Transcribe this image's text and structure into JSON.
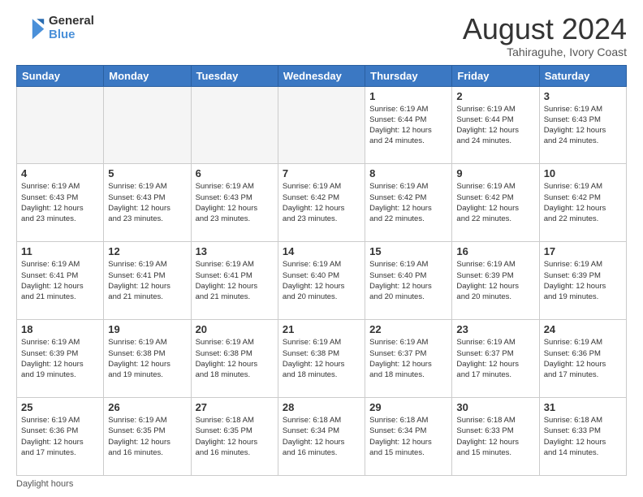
{
  "logo": {
    "line1": "General",
    "line2": "Blue"
  },
  "title": "August 2024",
  "subtitle": "Tahiraguhe, Ivory Coast",
  "days_of_week": [
    "Sunday",
    "Monday",
    "Tuesday",
    "Wednesday",
    "Thursday",
    "Friday",
    "Saturday"
  ],
  "footer": "Daylight hours",
  "weeks": [
    [
      {
        "day": "",
        "info": ""
      },
      {
        "day": "",
        "info": ""
      },
      {
        "day": "",
        "info": ""
      },
      {
        "day": "",
        "info": ""
      },
      {
        "day": "1",
        "info": "Sunrise: 6:19 AM\nSunset: 6:44 PM\nDaylight: 12 hours\nand 24 minutes."
      },
      {
        "day": "2",
        "info": "Sunrise: 6:19 AM\nSunset: 6:44 PM\nDaylight: 12 hours\nand 24 minutes."
      },
      {
        "day": "3",
        "info": "Sunrise: 6:19 AM\nSunset: 6:43 PM\nDaylight: 12 hours\nand 24 minutes."
      }
    ],
    [
      {
        "day": "4",
        "info": "Sunrise: 6:19 AM\nSunset: 6:43 PM\nDaylight: 12 hours\nand 23 minutes."
      },
      {
        "day": "5",
        "info": "Sunrise: 6:19 AM\nSunset: 6:43 PM\nDaylight: 12 hours\nand 23 minutes."
      },
      {
        "day": "6",
        "info": "Sunrise: 6:19 AM\nSunset: 6:43 PM\nDaylight: 12 hours\nand 23 minutes."
      },
      {
        "day": "7",
        "info": "Sunrise: 6:19 AM\nSunset: 6:42 PM\nDaylight: 12 hours\nand 23 minutes."
      },
      {
        "day": "8",
        "info": "Sunrise: 6:19 AM\nSunset: 6:42 PM\nDaylight: 12 hours\nand 22 minutes."
      },
      {
        "day": "9",
        "info": "Sunrise: 6:19 AM\nSunset: 6:42 PM\nDaylight: 12 hours\nand 22 minutes."
      },
      {
        "day": "10",
        "info": "Sunrise: 6:19 AM\nSunset: 6:42 PM\nDaylight: 12 hours\nand 22 minutes."
      }
    ],
    [
      {
        "day": "11",
        "info": "Sunrise: 6:19 AM\nSunset: 6:41 PM\nDaylight: 12 hours\nand 21 minutes."
      },
      {
        "day": "12",
        "info": "Sunrise: 6:19 AM\nSunset: 6:41 PM\nDaylight: 12 hours\nand 21 minutes."
      },
      {
        "day": "13",
        "info": "Sunrise: 6:19 AM\nSunset: 6:41 PM\nDaylight: 12 hours\nand 21 minutes."
      },
      {
        "day": "14",
        "info": "Sunrise: 6:19 AM\nSunset: 6:40 PM\nDaylight: 12 hours\nand 20 minutes."
      },
      {
        "day": "15",
        "info": "Sunrise: 6:19 AM\nSunset: 6:40 PM\nDaylight: 12 hours\nand 20 minutes."
      },
      {
        "day": "16",
        "info": "Sunrise: 6:19 AM\nSunset: 6:39 PM\nDaylight: 12 hours\nand 20 minutes."
      },
      {
        "day": "17",
        "info": "Sunrise: 6:19 AM\nSunset: 6:39 PM\nDaylight: 12 hours\nand 19 minutes."
      }
    ],
    [
      {
        "day": "18",
        "info": "Sunrise: 6:19 AM\nSunset: 6:39 PM\nDaylight: 12 hours\nand 19 minutes."
      },
      {
        "day": "19",
        "info": "Sunrise: 6:19 AM\nSunset: 6:38 PM\nDaylight: 12 hours\nand 19 minutes."
      },
      {
        "day": "20",
        "info": "Sunrise: 6:19 AM\nSunset: 6:38 PM\nDaylight: 12 hours\nand 18 minutes."
      },
      {
        "day": "21",
        "info": "Sunrise: 6:19 AM\nSunset: 6:38 PM\nDaylight: 12 hours\nand 18 minutes."
      },
      {
        "day": "22",
        "info": "Sunrise: 6:19 AM\nSunset: 6:37 PM\nDaylight: 12 hours\nand 18 minutes."
      },
      {
        "day": "23",
        "info": "Sunrise: 6:19 AM\nSunset: 6:37 PM\nDaylight: 12 hours\nand 17 minutes."
      },
      {
        "day": "24",
        "info": "Sunrise: 6:19 AM\nSunset: 6:36 PM\nDaylight: 12 hours\nand 17 minutes."
      }
    ],
    [
      {
        "day": "25",
        "info": "Sunrise: 6:19 AM\nSunset: 6:36 PM\nDaylight: 12 hours\nand 17 minutes."
      },
      {
        "day": "26",
        "info": "Sunrise: 6:19 AM\nSunset: 6:35 PM\nDaylight: 12 hours\nand 16 minutes."
      },
      {
        "day": "27",
        "info": "Sunrise: 6:18 AM\nSunset: 6:35 PM\nDaylight: 12 hours\nand 16 minutes."
      },
      {
        "day": "28",
        "info": "Sunrise: 6:18 AM\nSunset: 6:34 PM\nDaylight: 12 hours\nand 16 minutes."
      },
      {
        "day": "29",
        "info": "Sunrise: 6:18 AM\nSunset: 6:34 PM\nDaylight: 12 hours\nand 15 minutes."
      },
      {
        "day": "30",
        "info": "Sunrise: 6:18 AM\nSunset: 6:33 PM\nDaylight: 12 hours\nand 15 minutes."
      },
      {
        "day": "31",
        "info": "Sunrise: 6:18 AM\nSunset: 6:33 PM\nDaylight: 12 hours\nand 14 minutes."
      }
    ]
  ]
}
